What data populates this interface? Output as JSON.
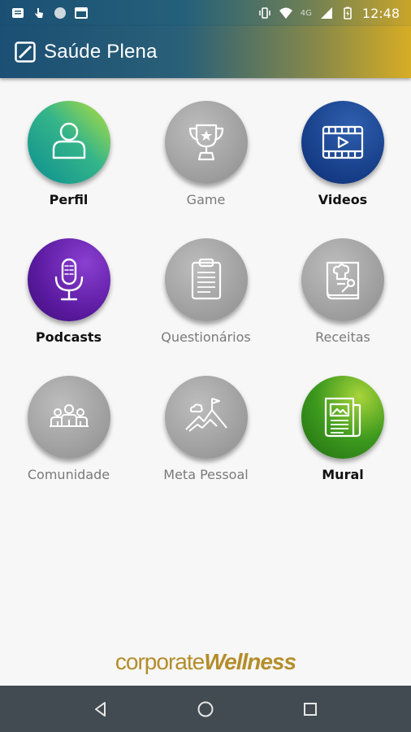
{
  "status_bar": {
    "time": "12:48",
    "network": "4G",
    "icons": [
      "notification-icon",
      "touch-icon",
      "circle-icon",
      "calendar-icon",
      "vibrate-icon",
      "wifi-icon",
      "signal-icon",
      "battery-icon"
    ]
  },
  "app_bar": {
    "title": "Saúde Plena",
    "logo": "app-logo-icon"
  },
  "tiles": [
    {
      "label": "Perfil",
      "icon": "person-icon",
      "active": true
    },
    {
      "label": "Game",
      "icon": "trophy-icon",
      "active": false
    },
    {
      "label": "Videos",
      "icon": "video-icon",
      "active": true
    },
    {
      "label": "Podcasts",
      "icon": "microphone-icon",
      "active": true
    },
    {
      "label": "Questionários",
      "icon": "clipboard-icon",
      "active": false
    },
    {
      "label": "Receitas",
      "icon": "recipe-book-icon",
      "active": false
    },
    {
      "label": "Comunidade",
      "icon": "community-icon",
      "active": false
    },
    {
      "label": "Meta Pessoal",
      "icon": "mountain-goal-icon",
      "active": false
    },
    {
      "label": "Mural",
      "icon": "newspaper-icon",
      "active": true
    }
  ],
  "brand": {
    "part1": "corporate",
    "part2": "Wellness",
    "color": "#b48d2b"
  },
  "nav": {
    "back": "back-icon",
    "home": "home-icon",
    "recents": "recents-icon"
  },
  "colors": {
    "app_bar_start": "#1b4f74",
    "app_bar_end": "#d7ad24",
    "nav_bar": "#424b51"
  }
}
